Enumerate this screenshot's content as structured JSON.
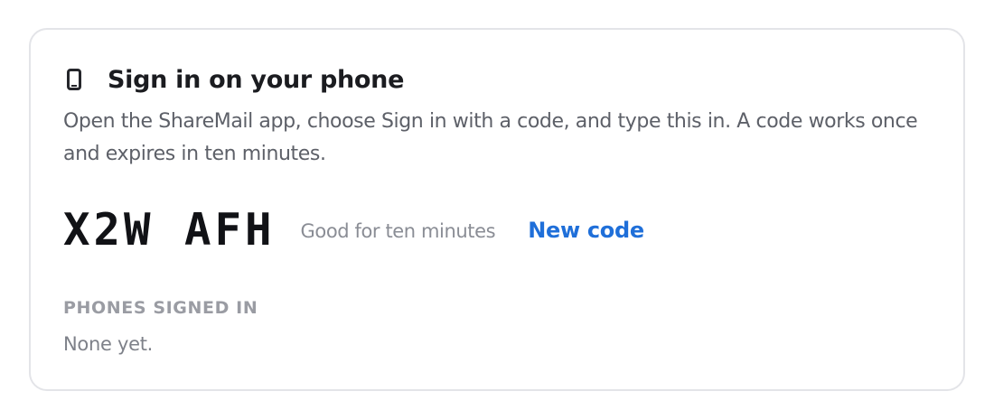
{
  "card": {
    "icon": "phone-icon",
    "title": "Sign in on your phone",
    "description": "Open the ShareMail app, choose Sign in with a code, and type this in. A code works once and expires in ten minutes.",
    "code": "X2W AFH",
    "validity": "Good for ten minutes",
    "new_code_label": "New code",
    "phones_section_label": "PHONES SIGNED IN",
    "phones_empty_text": "None yet."
  },
  "colors": {
    "accent": "#1f6fd9",
    "title": "#1b1c20",
    "muted": "#5d6068",
    "border": "#e3e4e8"
  }
}
